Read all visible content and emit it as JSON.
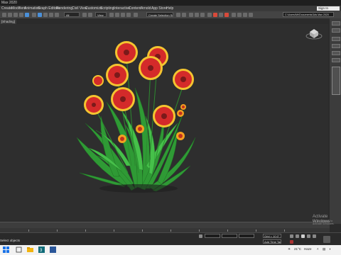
{
  "app": {
    "title": "Max 2020"
  },
  "menu": [
    "Create",
    "Modifiers",
    "Animation",
    "Graph Editors",
    "Rendering",
    "Civil View",
    "Customize",
    "Scripting",
    "Interactive",
    "Content",
    "Arnold",
    "App Store",
    "Help"
  ],
  "signin_label": "Sign In",
  "toolbar": {
    "filter_value": "All",
    "view_value": "View",
    "selection_set_placeholder": "Create Selection Se",
    "project_path": "C:\\Users\\Mr\\Documents\\3ds Max 2020"
  },
  "viewport": {
    "label": "[Shading]"
  },
  "status": {
    "left_text": "Select objects",
    "add_time_tag": "Add Time Tag",
    "grid_value": "Grid = 10.0\""
  },
  "windows_watermark": {
    "line1": "Activate Windows",
    "line2": "Go to Settings to activate Windows."
  },
  "taskbar": {
    "temperature": "21°C",
    "weather": "Haze"
  },
  "icons": [
    "undo-icon",
    "redo-icon",
    "link-icon",
    "unlink-icon",
    "select-icon",
    "move-icon",
    "rotate-icon",
    "scale-icon",
    "snap-icon",
    "render-icon",
    "viewcube-icon",
    "windows-start-icon",
    "search-icon",
    "taskview-icon",
    "explorer-icon",
    "3dsmax-icon",
    "play-icon",
    "key-icon"
  ],
  "colors": {
    "petal_red": "#d42a2a",
    "petal_tip": "#f4c430",
    "leaf_green": "#3aa83a",
    "viewport_bg": "#2e2e2e"
  }
}
